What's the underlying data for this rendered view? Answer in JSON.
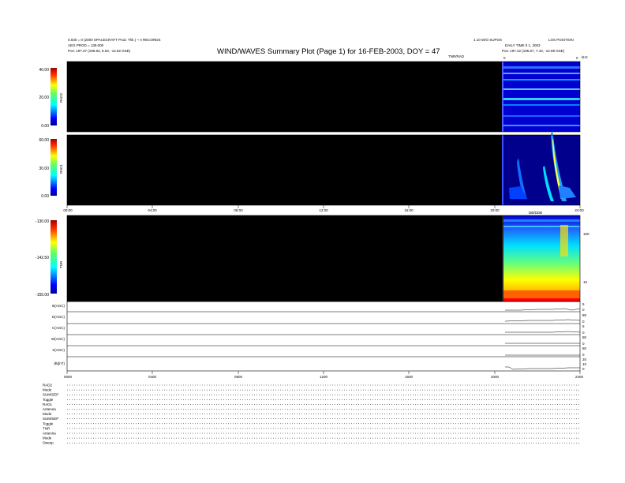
{
  "header": {
    "left_line1": "0.030 = 0 (2000 SPACECRAFT Prod. Thk.) ~ A RECORDS",
    "left_line2": "AEG PROD = 139.000",
    "left_line3": "Pos:    197.37 (195.83, 8.63, -12.92 GSE)",
    "right_line0": "LOS POSITION",
    "right_line1": "1.10 W/O SUPOS",
    "right_line2": "DAILY TIME 0 1, 2003",
    "right_line3": "Pos:    197.42 (195.67, 7.43, -12.89 GSE)",
    "title": "WIND/WAVES Summary Plot (Page 1) for 16-FEB-2003, DOY = 47",
    "tnr_label": "TNR/RAD",
    "unit_label": "kHz",
    "rad1_title": "DB/DDB",
    "top_axis_left": "0",
    "top_axis_right": "0"
  },
  "chart_data": [
    {
      "type": "heatmap",
      "panel": "RAD2",
      "colorbar_label": "RAD2",
      "colorbar_ticks": [
        "40.00",
        "20.00",
        "0.00"
      ],
      "colorbar_range": [
        0,
        40
      ],
      "x_range_hours": [
        0,
        24
      ],
      "data_start_hour": 20.7,
      "data_end_hour": 24.0
    },
    {
      "type": "heatmap",
      "panel": "RAD1",
      "colorbar_label": "RAD1",
      "colorbar_ticks": [
        "60.00",
        "30.00",
        "0.00"
      ],
      "colorbar_range": [
        0,
        60
      ],
      "x_range_hours": [
        0,
        24
      ],
      "data_start_hour": 20.7,
      "data_end_hour": 24.0,
      "x_tick_labels": [
        "00:00",
        "04:00",
        "08:00",
        "12:00",
        "16:00",
        "20:00",
        "24:00"
      ]
    },
    {
      "type": "heatmap",
      "panel": "TNR",
      "colorbar_label": "TNR",
      "colorbar_ticks": [
        "-130.00",
        "-142.50",
        "-155.00"
      ],
      "colorbar_range": [
        -155,
        -130
      ],
      "x_range_hours": [
        0,
        24
      ],
      "data_start_hour": 20.7,
      "data_end_hour": 24.0,
      "y_tick_labels": [
        "100",
        "10"
      ]
    },
    {
      "type": "line",
      "panels": [
        {
          "label": "B(AGC)",
          "ticks": [
            "5",
            "0"
          ]
        },
        {
          "label": "D(AGC)",
          "ticks": [
            "80",
            "0"
          ]
        },
        {
          "label": "C(AGC)",
          "ticks": [
            "5",
            "0"
          ]
        },
        {
          "label": "W(AGC)",
          "ticks": [
            "80",
            "0"
          ]
        },
        {
          "label": "X(AGC)",
          "ticks": [
            "80",
            "0"
          ]
        },
        {
          "label": "|B|(nT)",
          "ticks": [
            "20",
            "10",
            "0"
          ]
        }
      ],
      "x_range_hours": [
        0,
        24
      ],
      "data_start_hour": 20.7,
      "x_tick_labels": [
        "0000",
        "0400",
        "0800",
        "1200",
        "1600",
        "2000",
        "2400"
      ]
    }
  ],
  "modes": {
    "labels": [
      "RAD2",
      "Mode",
      "SUM/SEP",
      "Toggle",
      "RAD1",
      "Antenna",
      "Mode",
      "SUM/SEP",
      "Toggle",
      "TNR",
      "Antenna",
      "Mode",
      "Sweep"
    ]
  }
}
